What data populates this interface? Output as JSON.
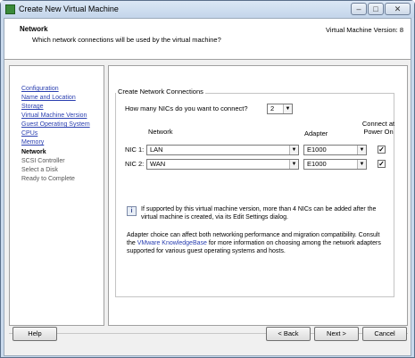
{
  "window": {
    "title": "Create New Virtual Machine"
  },
  "header": {
    "title": "Network",
    "subtitle": "Which network connections will be used by the virtual machine?",
    "version": "Virtual Machine Version: 8"
  },
  "sidebar": {
    "items": [
      {
        "label": "Configuration",
        "state": "link"
      },
      {
        "label": "Name and Location",
        "state": "link"
      },
      {
        "label": "Storage",
        "state": "link"
      },
      {
        "label": "Virtual Machine Version",
        "state": "link"
      },
      {
        "label": "Guest Operating System",
        "state": "link"
      },
      {
        "label": "CPUs",
        "state": "link"
      },
      {
        "label": "Memory",
        "state": "link"
      },
      {
        "label": "Network",
        "state": "current"
      },
      {
        "label": "SCSI Controller",
        "state": "future"
      },
      {
        "label": "Select a Disk",
        "state": "future"
      },
      {
        "label": "Ready to Complete",
        "state": "future"
      }
    ]
  },
  "main": {
    "group_label": "Create Network Connections",
    "nic_count_question": "How many NICs do you want to connect?",
    "nic_count_value": "2",
    "columns": {
      "network": "Network",
      "adapter": "Adapter",
      "connect": "Connect at Power On"
    },
    "nics": [
      {
        "label": "NIC 1:",
        "network": "LAN",
        "adapter": "E1000",
        "connect": true
      },
      {
        "label": "NIC 2:",
        "network": "WAN",
        "adapter": "E1000",
        "connect": true
      }
    ],
    "info_text": "If supported by this virtual machine version, more than 4 NICs can be added after the virtual machine is created, via its Edit Settings dialog.",
    "adapter_text_before": "Adapter choice can affect both networking performance and migration compatibility. Consult the ",
    "adapter_link": "VMware KnowledgeBase",
    "adapter_text_after": " for more information on choosing among the network adapters supported for various guest operating systems and hosts."
  },
  "footer": {
    "help": "Help",
    "back": "< Back",
    "next": "Next >",
    "cancel": "Cancel"
  },
  "icons": {
    "app": "vm-app-icon",
    "info": "info-icon",
    "dropdown": "chevron-down-icon",
    "check": "checkmark-icon"
  }
}
